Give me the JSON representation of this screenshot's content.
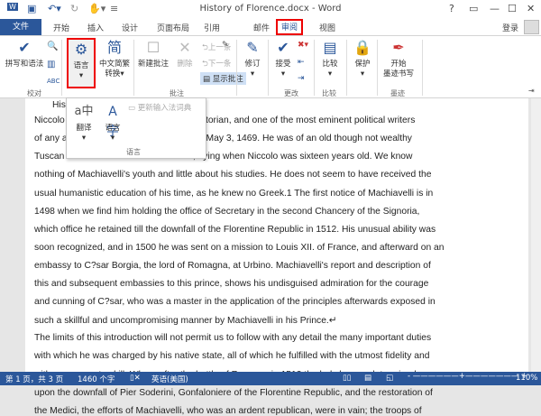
{
  "window": {
    "title": "History of Florence.docx - Word",
    "help": "?",
    "restore": "▭",
    "minimize": "—",
    "maximize": "☐",
    "close": "✕"
  },
  "tabs": [
    "文件",
    "开始",
    "插入",
    "设计",
    "页面布局",
    "引用",
    "邮件",
    "审阅",
    "视图"
  ],
  "signin": "登录",
  "ribbon": {
    "spelling": "拼写和语法",
    "proofing_group": "校对",
    "language": "语言",
    "chinese_conv": "中文简繁",
    "chinese_conv2": "转换",
    "new_comment": "新建批注",
    "delete": "删除",
    "prev": "上一条",
    "next": "下一条",
    "show_comments": "显示批注",
    "comments_group": "批注",
    "track": "修订",
    "accept": "接受",
    "changes_group": "更改",
    "compare": "比较",
    "compare_group": "比较",
    "protect": "保护",
    "ink_start": "开始",
    "ink_start2": "墨迹书写",
    "ink_group": "墨迹"
  },
  "popup": {
    "translate": "翻译",
    "language": "语言",
    "update_ime": "更新输入法词典",
    "group": "语言"
  },
  "document": {
    "lines": [
      "Histo",
      "Niccolo                                               n historian, and one of the most eminent political writers",
      "of any a                                              nce, May 3, 1469. He was of an old though not wealthy",
      "Tuscan f                                             st, dying when Niccolo was sixteen years old. We know",
      "nothing of Machiavelli's youth and little about his studies. He does not seem to have received the",
      "usual humanistic education of his time, as he knew no Greek.1 The first notice of Machiavelli is in",
      "1498 when we find him holding the office of Secretary in the second Chancery of the Signoria,",
      "which office he retained till the downfall of the Florentine Republic in 1512. His unusual ability was",
      "soon recognized, and in 1500 he was sent on a mission to Louis XII. of France, and afterward on an",
      "embassy to C?sar Borgia, the lord of Romagna, at Urbino. Machiavelli's report and description of",
      "this and subsequent embassies to this prince, shows his undisguised admiration for the courage",
      "and cunning of C?sar, who was a master in the application of the principles afterwards exposed in",
      "such a skillful and uncompromising manner by Machiavelli in his Prince.↵",
      "The limits of this introduction will not permit us to follow with any detail the many important duties",
      "with which he was charged by his native state, all of which he fulfilled with the utmost fidelity and",
      "with consummate skill. When, after the battle of Ravenna in 1512 the holy league determined",
      "upon the downfall of Pier Soderini, Gonfaloniere of the Florentine Republic, and the restoration of",
      "the Medici, the efforts of Machiavelli, who was an ardent republican, were in vain; the troops of"
    ]
  },
  "status": {
    "page": "第 1 页，共 3 页",
    "words": "1460 个字",
    "lang": "英语(美国)",
    "zoom": "110%"
  }
}
